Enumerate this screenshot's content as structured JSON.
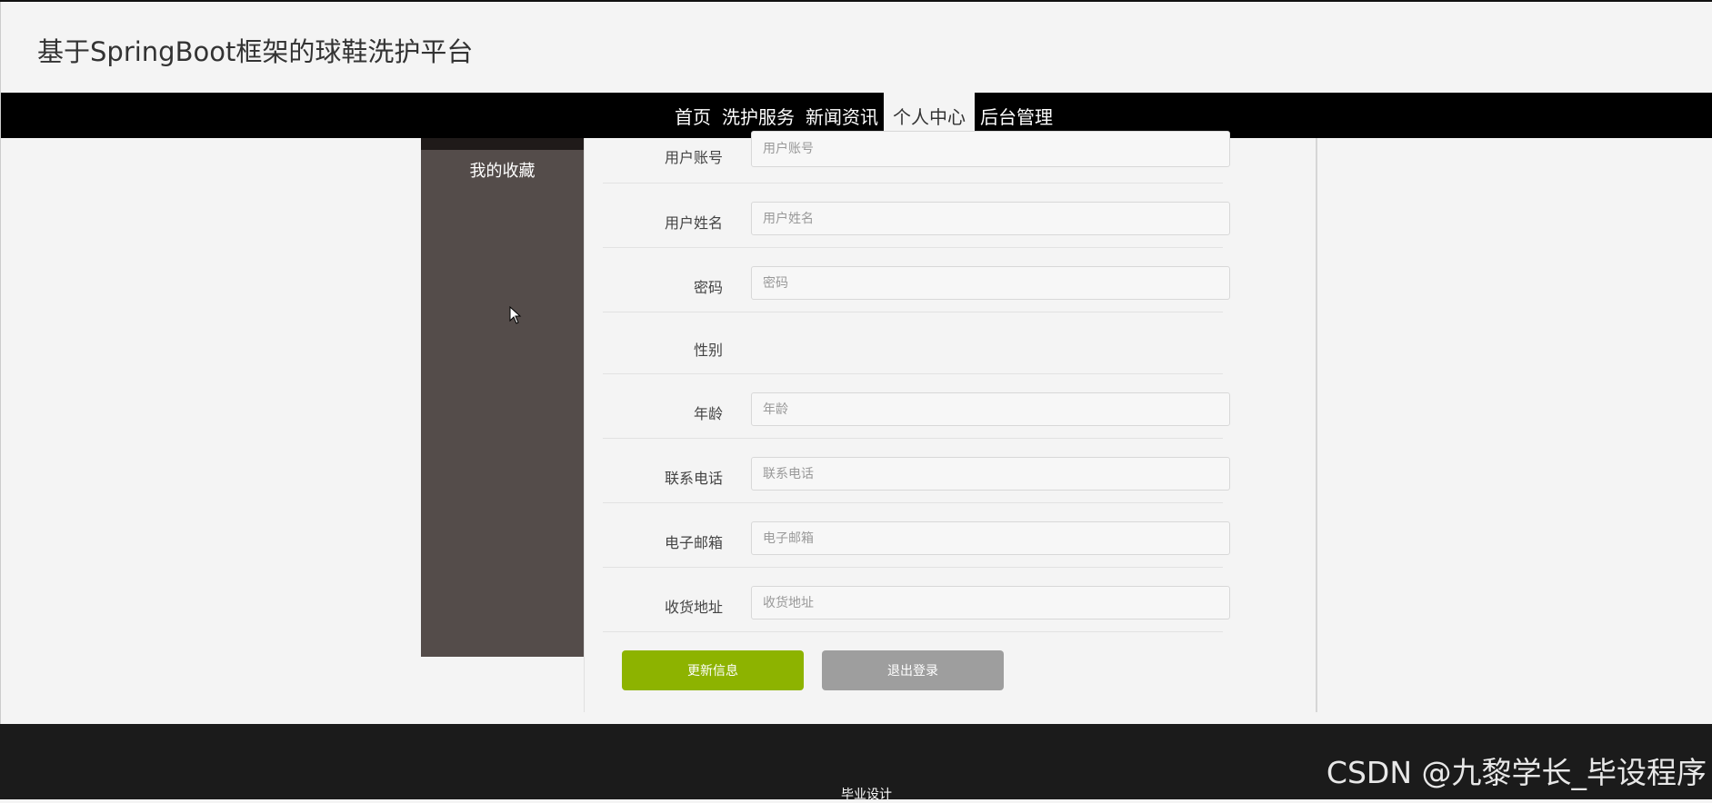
{
  "site": {
    "title": "基于SpringBoot框架的球鞋洗护平台"
  },
  "nav": {
    "items": [
      {
        "label": "首页",
        "active": false
      },
      {
        "label": "洗护服务",
        "active": false
      },
      {
        "label": "新闻资讯",
        "active": false
      },
      {
        "label": "个人中心",
        "active": true
      },
      {
        "label": "后台管理",
        "active": false
      }
    ]
  },
  "sidebar": {
    "items": [
      {
        "label": "我的收藏"
      }
    ]
  },
  "form": {
    "fields": [
      {
        "label": "用户账号",
        "placeholder": "用户账号",
        "value": ""
      },
      {
        "label": "用户姓名",
        "placeholder": "用户姓名",
        "value": ""
      },
      {
        "label": "密码",
        "placeholder": "密码",
        "value": ""
      },
      {
        "label": "性别"
      },
      {
        "label": "年龄",
        "placeholder": "年龄",
        "value": ""
      },
      {
        "label": "联系电话",
        "placeholder": "联系电话",
        "value": ""
      },
      {
        "label": "电子邮箱",
        "placeholder": "电子邮箱",
        "value": ""
      },
      {
        "label": "收货地址",
        "placeholder": "收货地址",
        "value": ""
      }
    ],
    "update_button": "更新信息",
    "logout_button": "退出登录"
  },
  "footer": {
    "text": "毕业设计"
  },
  "watermark": "CSDN @九黎学长_毕设程序",
  "colors": {
    "navbar": "#000000",
    "sidebar": "#544c4a",
    "update_button": "#8db300",
    "logout_button": "#9e9e9e",
    "footer": "#1b1b1b"
  }
}
